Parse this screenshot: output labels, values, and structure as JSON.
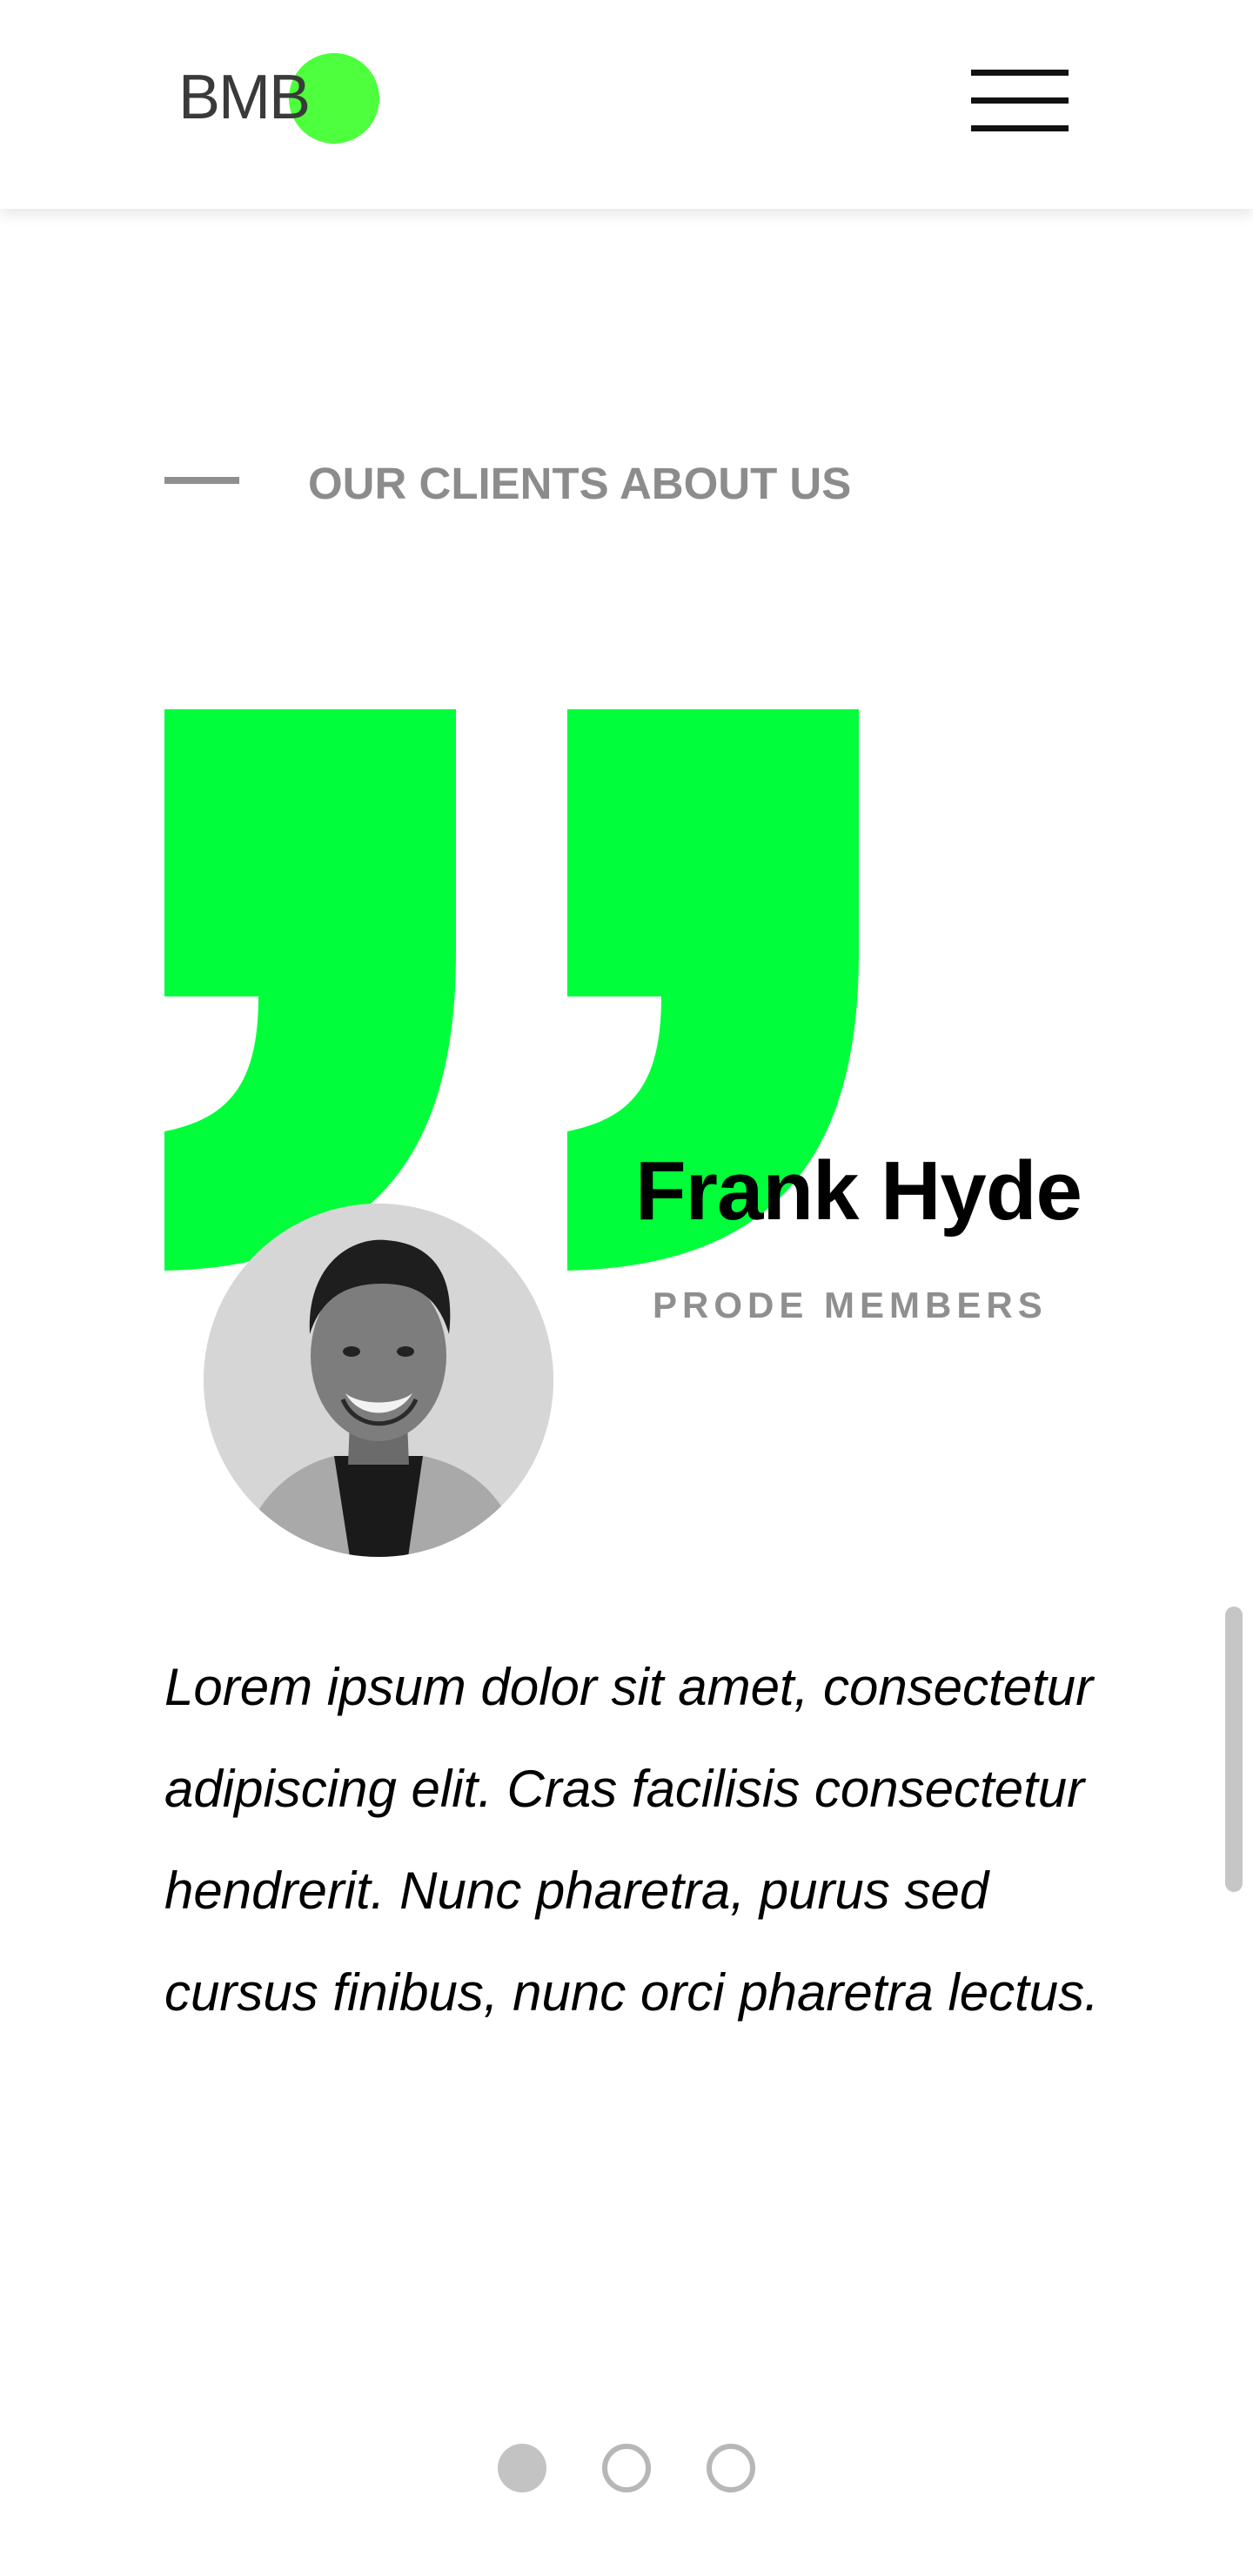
{
  "header": {
    "logo_text": "BMB",
    "menu_icon": "hamburger-menu-icon"
  },
  "section": {
    "title": "OUR CLIENTS ABOUT US"
  },
  "testimonial": {
    "quote_icon": "quote-marks-icon",
    "name": "Frank Hyde",
    "role": "PRODE MEMBERS",
    "text": "Lorem ipsum dolor sit amet, consectetur adipiscing elit. Cras facilisis consectetur hendrerit. Nunc pharetra, purus sed cursus finibus, nunc orci pharetra lectus."
  },
  "pagination": {
    "count": 3,
    "active_index": 0
  },
  "colors": {
    "accent": "#00ff3a",
    "logo_dot": "#4dff3d",
    "muted_text": "#8c8c8c",
    "text": "#000000"
  }
}
